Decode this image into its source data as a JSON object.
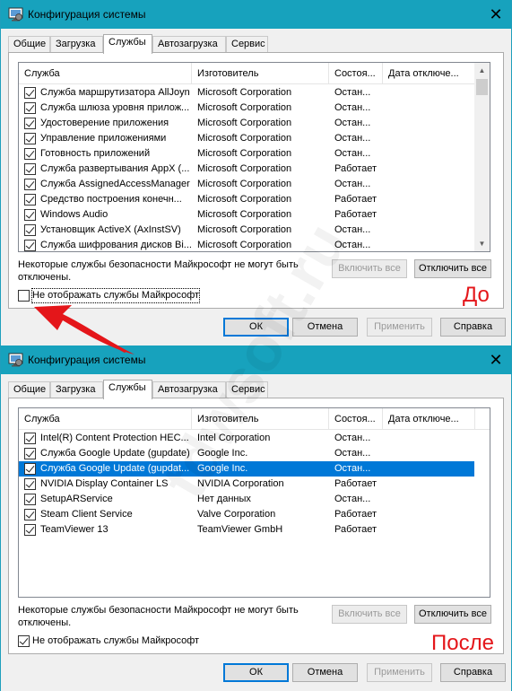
{
  "window_title": "Конфигурация системы",
  "close_glyph": "✕",
  "tabs": [
    "Общие",
    "Загрузка",
    "Службы",
    "Автозагрузка",
    "Сервис"
  ],
  "columns": [
    "Служба",
    "Изготовитель",
    "Состоя...",
    "Дата отключе..."
  ],
  "before": {
    "rows": [
      {
        "name": "Служба маршрутизатора AllJoyn",
        "mfr": "Microsoft Corporation",
        "status": "Остан..."
      },
      {
        "name": "Служба шлюза уровня прилож...",
        "mfr": "Microsoft Corporation",
        "status": "Остан..."
      },
      {
        "name": "Удостоверение приложения",
        "mfr": "Microsoft Corporation",
        "status": "Остан..."
      },
      {
        "name": "Управление приложениями",
        "mfr": "Microsoft Corporation",
        "status": "Остан..."
      },
      {
        "name": "Готовность приложений",
        "mfr": "Microsoft Corporation",
        "status": "Остан..."
      },
      {
        "name": "Служба развертывания AppX (...",
        "mfr": "Microsoft Corporation",
        "status": "Работает"
      },
      {
        "name": "Служба AssignedAccessManager",
        "mfr": "Microsoft Corporation",
        "status": "Остан..."
      },
      {
        "name": "Средство построения конечн...",
        "mfr": "Microsoft Corporation",
        "status": "Работает"
      },
      {
        "name": "Windows Audio",
        "mfr": "Microsoft Corporation",
        "status": "Работает"
      },
      {
        "name": "Установщик ActiveX (AxInstSV)",
        "mfr": "Microsoft Corporation",
        "status": "Остан..."
      },
      {
        "name": "Служба шифрования дисков Bi...",
        "mfr": "Microsoft Corporation",
        "status": "Остан..."
      }
    ],
    "hide_ms_checked": false,
    "caption": "До"
  },
  "after": {
    "rows": [
      {
        "name": "Intel(R) Content Protection HEC...",
        "mfr": "Intel Corporation",
        "status": "Остан..."
      },
      {
        "name": "Служба Google Update (gupdate)",
        "mfr": "Google Inc.",
        "status": "Остан..."
      },
      {
        "name": "Служба Google Update (gupdat...",
        "mfr": "Google Inc.",
        "status": "Остан...",
        "selected": true
      },
      {
        "name": "NVIDIA Display Container LS",
        "mfr": "NVIDIA Corporation",
        "status": "Работает"
      },
      {
        "name": "SetupARService",
        "mfr": "Нет данных",
        "status": "Остан..."
      },
      {
        "name": "Steam Client Service",
        "mfr": "Valve Corporation",
        "status": "Работает"
      },
      {
        "name": "TeamViewer 13",
        "mfr": "TeamViewer GmbH",
        "status": "Работает"
      }
    ],
    "hide_ms_checked": true,
    "caption": "После"
  },
  "note": "Некоторые службы безопасности Майкрософт не могут быть отключены.",
  "enable_all_label": "Включить все",
  "disable_all_label": "Отключить все",
  "hide_ms_label": "Не отображать службы Майкрософт",
  "ok_label": "ОК",
  "cancel_label": "Отмена",
  "apply_label": "Применить",
  "help_label": "Справка",
  "watermark": "tdwsoft.ru",
  "colors": {
    "titlebar": "#17a2bd",
    "selection": "#0078d7",
    "annotation": "#e4161a"
  }
}
